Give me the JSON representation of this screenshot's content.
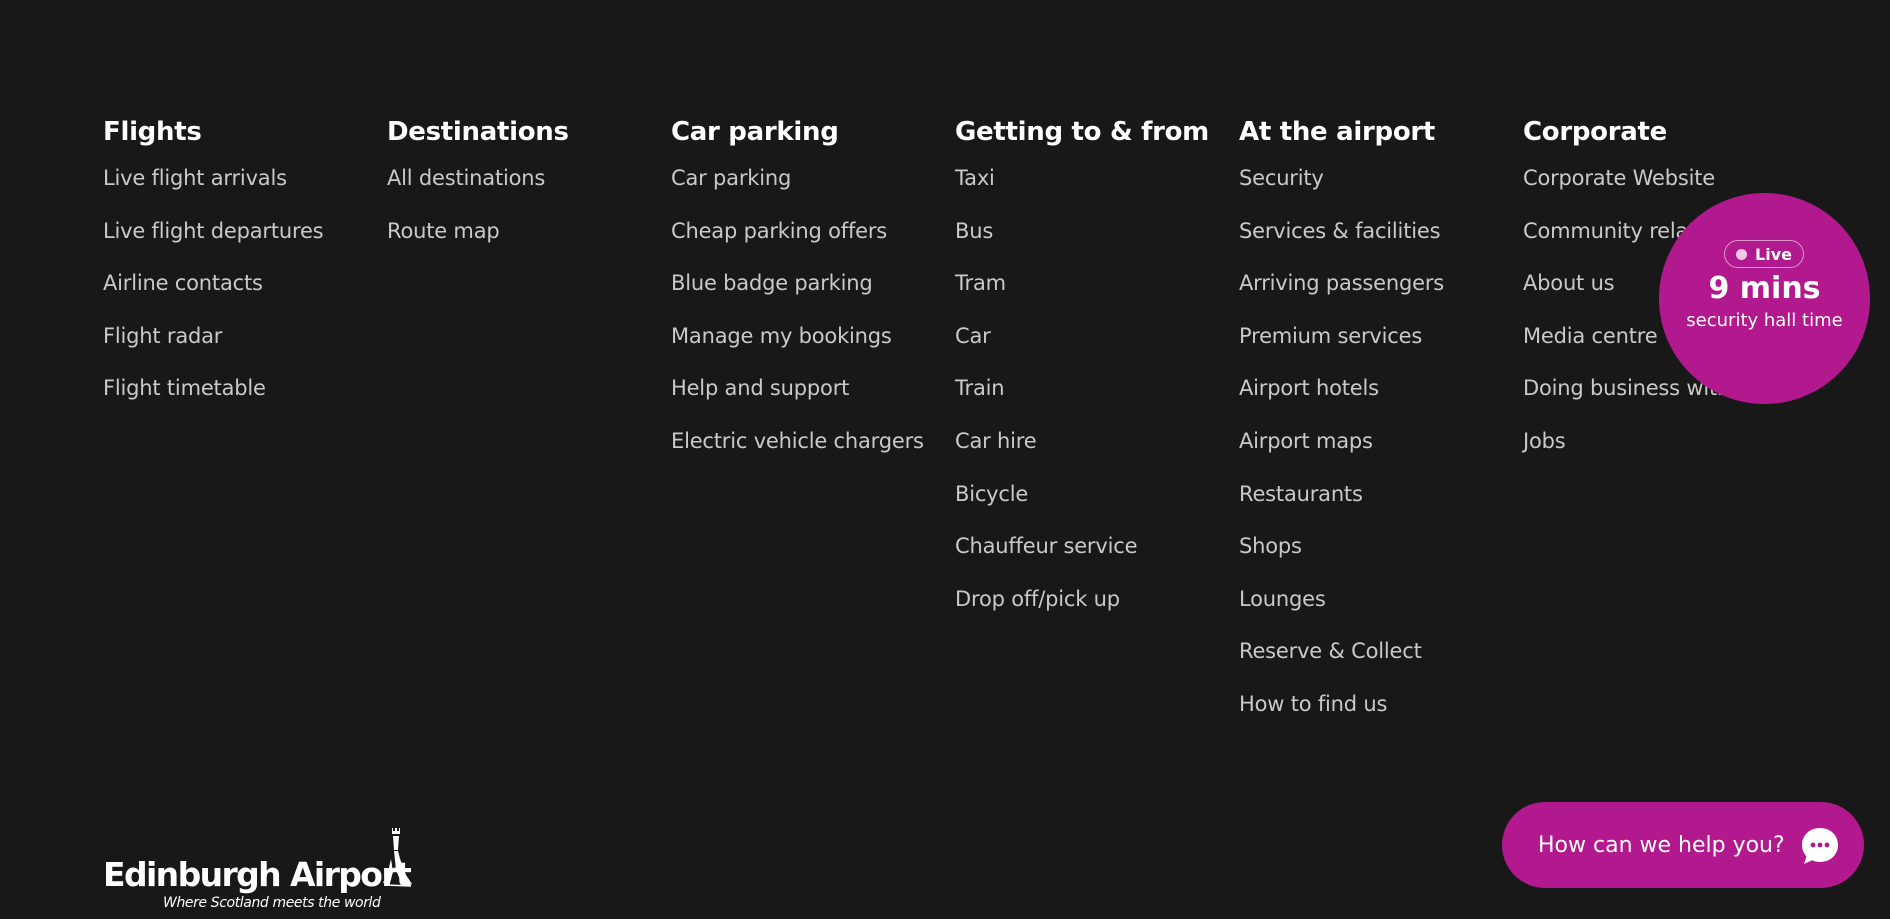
{
  "footer_nav": {
    "columns": [
      {
        "heading": "Flights",
        "links": [
          "Live flight arrivals",
          "Live flight departures",
          "Airline contacts",
          "Flight radar",
          "Flight timetable"
        ]
      },
      {
        "heading": "Destinations",
        "links": [
          "All destinations",
          "Route map"
        ]
      },
      {
        "heading": "Car parking",
        "links": [
          "Car parking",
          "Cheap parking offers",
          "Blue badge parking",
          "Manage my bookings",
          "Help and support",
          "Electric vehicle chargers"
        ]
      },
      {
        "heading": "Getting to & from",
        "links": [
          "Taxi",
          "Bus",
          "Tram",
          "Car",
          "Train",
          "Car hire",
          "Bicycle",
          "Chauffeur service",
          "Drop off/pick up"
        ]
      },
      {
        "heading": "At the airport",
        "links": [
          "Security",
          "Services & facilities",
          "Arriving passengers",
          "Premium services",
          "Airport hotels",
          "Airport maps",
          "Restaurants",
          "Shops",
          "Lounges",
          "Reserve & Collect",
          "How to find us"
        ]
      },
      {
        "heading": "Corporate",
        "links": [
          "Corporate Website",
          "Community relations",
          "About us",
          "Media centre",
          "Doing business with us",
          "Jobs"
        ]
      }
    ]
  },
  "live_security": {
    "badge_label": "Live",
    "wait_time": "9 mins",
    "caption": "security hall time"
  },
  "logo": {
    "name": "Edinburgh Airport",
    "tagline": "Where Scotland meets the world"
  },
  "help": {
    "label": "How can we help you?",
    "icon": "chat-bubble-icon"
  },
  "colors": {
    "background": "#181818",
    "accent": "#b2198f",
    "link_text": "#c9c9c9",
    "heading_text": "#ffffff"
  }
}
